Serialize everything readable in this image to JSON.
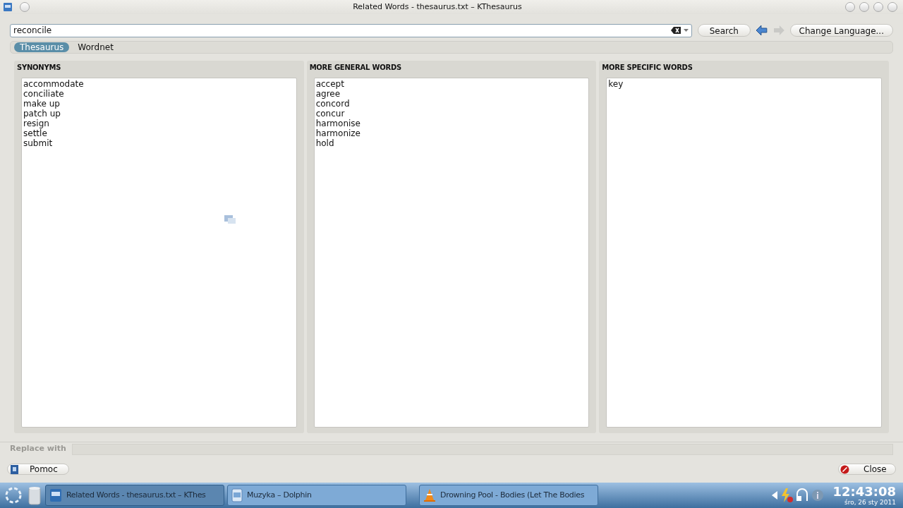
{
  "window": {
    "title": "Related Words - thesaurus.txt – KThesaurus"
  },
  "search": {
    "value": "reconcile",
    "button": "Search",
    "language_button": "Change Language..."
  },
  "tabs": [
    {
      "label": "Thesaurus",
      "selected": true
    },
    {
      "label": "Wordnet",
      "selected": false
    }
  ],
  "columns": [
    {
      "title": "SYNONYMS",
      "items": [
        "accommodate",
        "conciliate",
        "make up",
        "patch up",
        "resign",
        "settle",
        "submit"
      ]
    },
    {
      "title": "MORE GENERAL WORDS",
      "items": [
        "accept",
        "agree",
        "concord",
        "concur",
        "harmonise",
        "harmonize",
        "hold"
      ]
    },
    {
      "title": "MORE SPECIFIC WORDS",
      "items": [
        "key"
      ]
    }
  ],
  "replace": {
    "label": "Replace with",
    "disabled": true
  },
  "help_button": "Pomoc",
  "close_button": "Close",
  "taskbar": {
    "tasks": [
      {
        "label": "Related Words - thesaurus.txt – KThes",
        "selected": true,
        "kind": "book"
      },
      {
        "label": "Muzyka – Dolphin",
        "selected": false,
        "kind": "folder"
      },
      {
        "label": "Drowning Pool - Bodies (Let The Bodies",
        "selected": false,
        "kind": "cone"
      }
    ],
    "time": "12:43:08",
    "date": "śro, 26 sty 2011"
  }
}
